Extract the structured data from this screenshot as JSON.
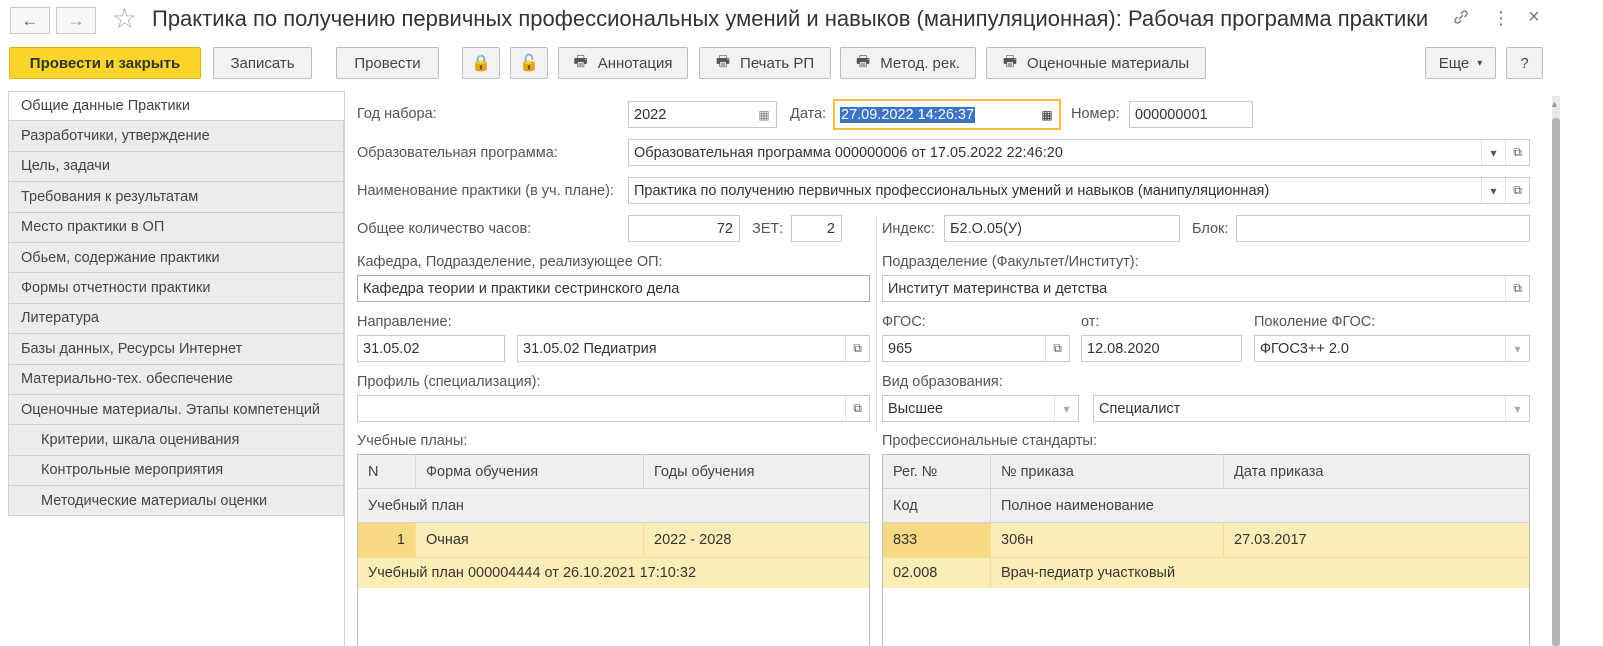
{
  "window": {
    "title": "Практика по получению первичных  профессиональных умений и навыков (манипуляционная): Рабочая программа практики",
    "back_icon": "←",
    "forward_icon": "→",
    "star_icon": "☆",
    "link_icon": "🔗",
    "more_icon": "⋮",
    "close_icon": "×"
  },
  "toolbar": {
    "post_close": "Провести и закрыть",
    "save": "Записать",
    "post": "Провести",
    "annotation": "Аннотация",
    "print_rp": "Печать РП",
    "method_rec": "Метод. рек.",
    "assessment": "Оценочные материалы",
    "more": "Еще",
    "more_arrow": "▾",
    "help": "?",
    "print_icon": "🖶",
    "lock_icon": "🔒",
    "unlock_icon": "🔓"
  },
  "sidebar": {
    "items": [
      "Общие данные Практики",
      "Разработчики, утверждение",
      "Цель, задачи",
      "Требования к результатам",
      "Место практики в ОП",
      "Обьем, содержание практики",
      "Формы отчетности практики",
      "Литература",
      "Базы данных, Ресурсы Интернет",
      "Материально-тех. обеспечение",
      "Оценочные материалы. Этапы компетенций",
      "Критерии, шкала оценивания",
      "Контрольные мероприятия",
      "Методические материалы оценки"
    ]
  },
  "form": {
    "year_label": "Год набора:",
    "year_value": "2022",
    "date_label": "Дата:",
    "date_value": "27.09.2022 14:26:37",
    "number_label": "Номер:",
    "number_value": "000000001",
    "program_label": "Образовательная программа:",
    "program_value": "Образовательная программа 000000006 от 17.05.2022 22:46:20",
    "practice_name_label": "Наименование практики (в уч. плане):",
    "practice_name_value": "Практика по получению первичных  профессиональных умений и навыков (манипуляционная)",
    "hours_label": "Общее количество часов:",
    "hours_value": "72",
    "zet_label": "ЗЕТ:",
    "zet_value": "2",
    "index_label": "Индекс:",
    "index_value": "Б2.О.05(У)",
    "block_label": "Блок:",
    "block_value": "",
    "dept_label": "Кафедра, Подразделение, реализующее ОП:",
    "dept_value": "Кафедра теории и практики сестринского дела",
    "division_label": "Подразделение (Факультет/Институт):",
    "division_value": "Институт материнства и детства",
    "direction_label": "Направление:",
    "direction_code": "31.05.02",
    "direction_name": "31.05.02 Педиатрия",
    "fgos_label": "ФГОС:",
    "fgos_value": "965",
    "from_label": "от:",
    "from_value": "12.08.2020",
    "fgos_gen_label": "Поколение ФГОС:",
    "fgos_gen_value": "ФГОС3++ 2.0",
    "profile_label": "Профиль (специализация):",
    "profile_value": "",
    "edu_type_label": "Вид образования:",
    "edu_type_value": "Высшее",
    "edu_level_value": "Специалист",
    "calendar_icon": "▦",
    "dropdown_icon": "▾",
    "open_icon": "⧉"
  },
  "study_plans": {
    "label": "Учебные планы:",
    "headers": [
      "N",
      "Форма обучения",
      "Годы обучения"
    ],
    "subheader": "Учебный план",
    "row": {
      "n": "1",
      "form": "Очная",
      "years": "2022 - 2028"
    },
    "row_plan": "Учебный план 000004444 от 26.10.2021 17:10:32"
  },
  "prof_standards": {
    "label": "Профессиональные стандарты:",
    "headers": [
      "Рег. №",
      "№ приказа",
      "Дата приказа"
    ],
    "subheaders": [
      "Код",
      "Полное наименование"
    ],
    "row": {
      "reg": "833",
      "order": "306н",
      "date": "27.03.2017"
    },
    "row_detail": {
      "code": "02.008",
      "name": "Врач-педиатр участковый"
    }
  }
}
